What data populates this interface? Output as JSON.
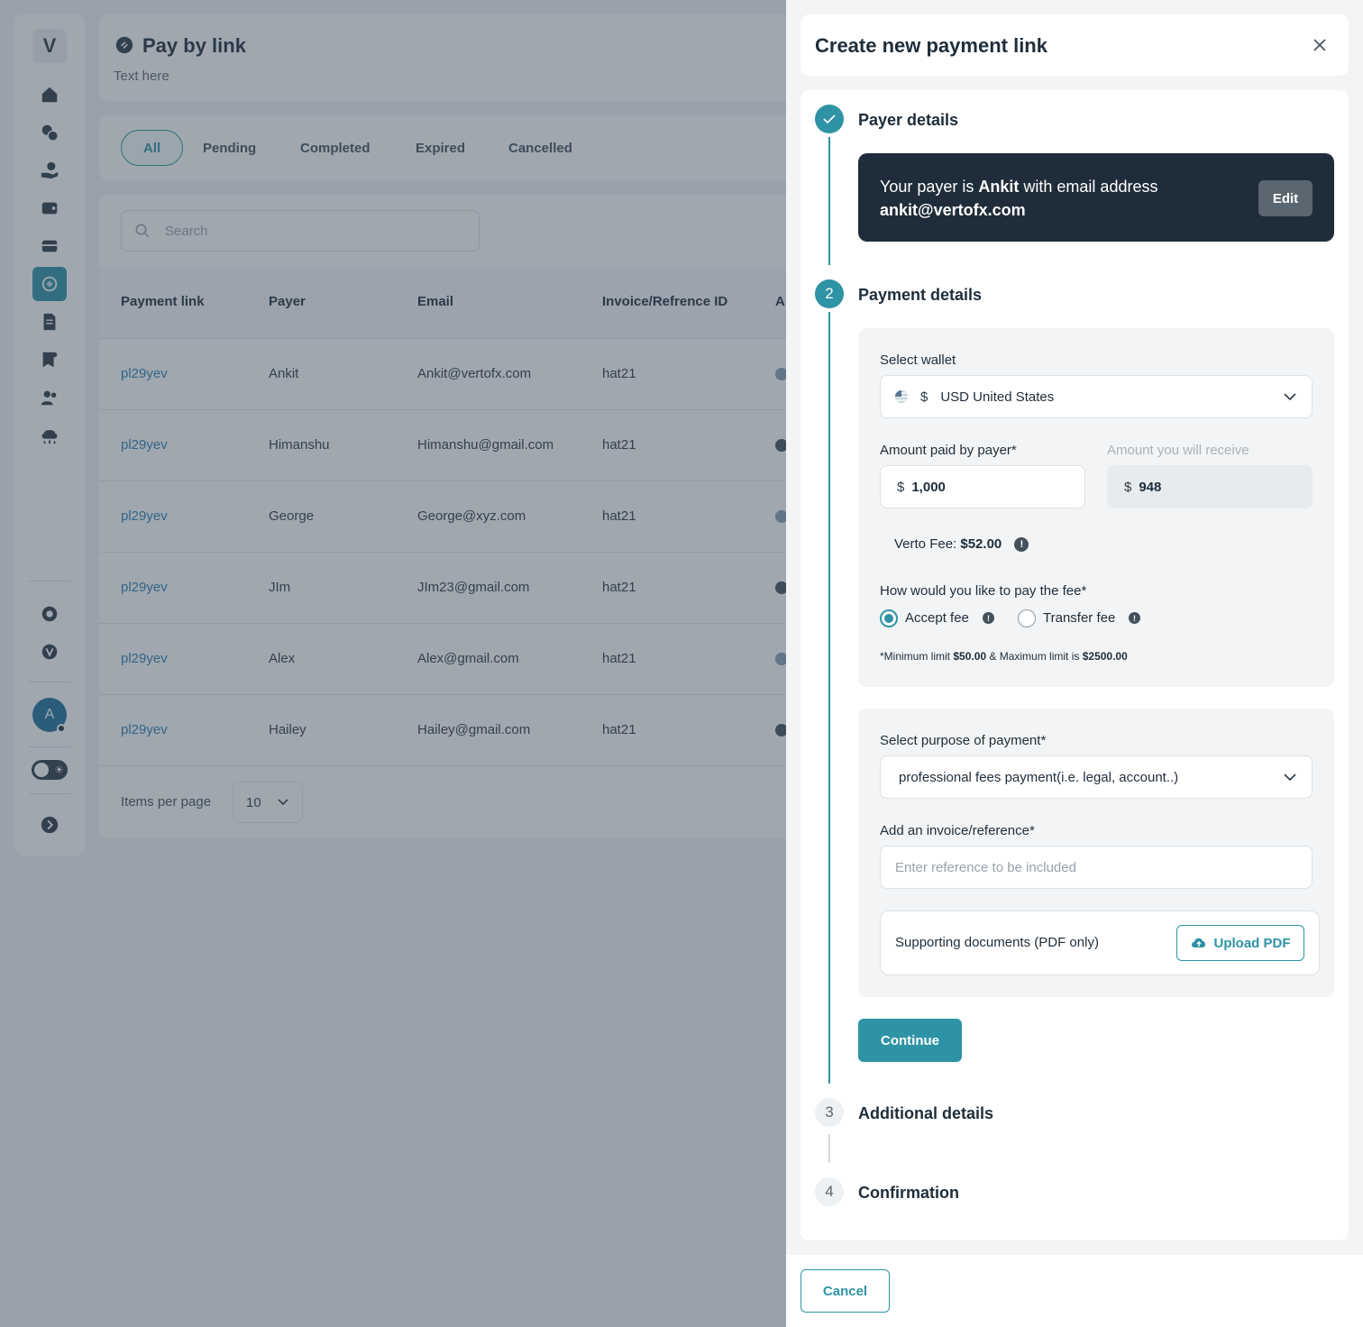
{
  "app": {
    "logo_letter": "V",
    "page_title": "Pay by link",
    "page_subtitle": "Text here",
    "avatar_initial": "A",
    "tabs": [
      {
        "label": "All"
      },
      {
        "label": "Pending"
      },
      {
        "label": "Completed"
      },
      {
        "label": "Expired"
      },
      {
        "label": "Cancelled"
      }
    ],
    "search_placeholder": "Search",
    "table": {
      "headers": [
        "Payment link",
        "Payer",
        "Email",
        "Invoice/Refrence ID",
        "A"
      ],
      "rows": [
        {
          "link": "pl29yev",
          "payer": "Ankit",
          "email": "Ankit@vertofx.com",
          "invoice": "hat21"
        },
        {
          "link": "pl29yev",
          "payer": "Himanshu",
          "email": "Himanshu@gmail.com",
          "invoice": "hat21"
        },
        {
          "link": "pl29yev",
          "payer": "George",
          "email": "George@xyz.com",
          "invoice": "hat21"
        },
        {
          "link": "pl29yev",
          "payer": "JIm",
          "email": "JIm23@gmail.com",
          "invoice": "hat21"
        },
        {
          "link": "pl29yev",
          "payer": "Alex",
          "email": "Alex@gmail.com",
          "invoice": "hat21"
        },
        {
          "link": "pl29yev",
          "payer": "Hailey",
          "email": "Hailey@gmail.com",
          "invoice": "hat21"
        }
      ]
    },
    "items_per_page_label": "Items per page",
    "items_per_page_value": "10"
  },
  "drawer": {
    "title": "Create new payment link",
    "steps": [
      {
        "number": "",
        "title": "Payer details"
      },
      {
        "number": "2",
        "title": "Payment details"
      },
      {
        "number": "3",
        "title": "Additional details"
      },
      {
        "number": "4",
        "title": "Confirmation"
      }
    ],
    "payer": {
      "prefix": "Your payer is ",
      "name": "Ankit",
      "middle": " with email address",
      "email": "ankit@vertofx.com",
      "edit_label": "Edit"
    },
    "wallet": {
      "label": "Select wallet",
      "currency_symbol": "$",
      "value": "USD United States"
    },
    "amount_paid": {
      "label": "Amount paid by payer*",
      "currency_symbol": "$",
      "value": "1,000"
    },
    "amount_receive": {
      "label": "Amount you will receive",
      "currency_symbol": "$",
      "value": "948"
    },
    "fee": {
      "label": "Verto Fee: ",
      "value": "$52.00"
    },
    "fee_option": {
      "label": "How would you like to pay the fee*",
      "accept_label": "Accept fee",
      "transfer_label": "Transfer fee",
      "selected": "accept"
    },
    "limits": {
      "prefix": "*Minimum limit ",
      "min": "$50.00",
      "middle": " & Maximum limit is ",
      "max": "$2500.00"
    },
    "purpose": {
      "label": "Select purpose of payment*",
      "value": "professional fees payment(i.e. legal, account..)"
    },
    "reference": {
      "label": "Add an invoice/reference*",
      "placeholder": "Enter reference to be included"
    },
    "documents": {
      "label": "Supporting documents (PDF only)",
      "upload_label": "Upload PDF"
    },
    "continue_label": "Continue",
    "cancel_label": "Cancel"
  },
  "colors": {
    "accent": "#2e93a5",
    "dark": "#1f2d3a",
    "overlay": "rgba(56,72,88,0.48)"
  }
}
